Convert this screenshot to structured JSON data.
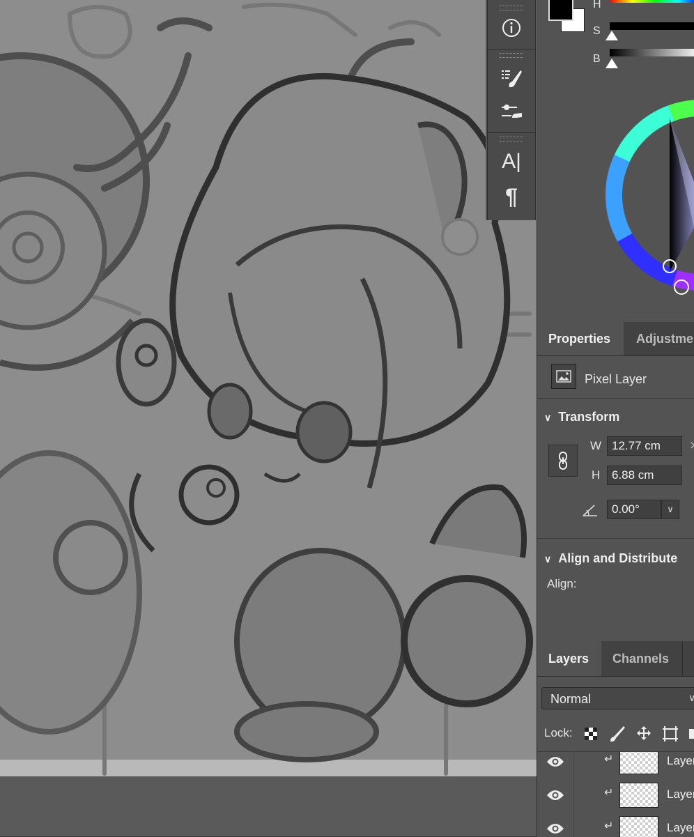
{
  "toolbar_strip": {
    "tools": [
      {
        "icon": "info-icon",
        "glyph": "ⓘ"
      },
      {
        "icon": "brush-presets-icon",
        "glyph": ""
      },
      {
        "icon": "brush-settings-icon",
        "glyph": ""
      },
      {
        "icon": "character-icon",
        "glyph": "A|"
      },
      {
        "icon": "paragraph-icon",
        "glyph": "¶"
      }
    ]
  },
  "color_panel": {
    "channels": [
      {
        "label": "H"
      },
      {
        "label": "S"
      },
      {
        "label": "B"
      }
    ],
    "foreground_color": "#000000",
    "background_color": "#ffffff"
  },
  "properties_panel": {
    "tabs": [
      {
        "label": "Properties",
        "active": true
      },
      {
        "label": "Adjustme",
        "active": false
      }
    ],
    "layer_type": "Pixel Layer",
    "transform": {
      "title": "Transform",
      "w_label": "W",
      "w_value": "12.77 cm",
      "h_label": "H",
      "h_value": "6.88 cm",
      "angle_value": "0.00°"
    },
    "align": {
      "title": "Align and Distribute",
      "align_label": "Align:"
    }
  },
  "layers_panel": {
    "tabs": [
      {
        "label": "Layers",
        "active": true
      },
      {
        "label": "Channels",
        "active": false
      }
    ],
    "blend_mode": "Normal",
    "lock_label": "Lock:",
    "layers": [
      {
        "name": "Layer"
      },
      {
        "name": "Layer"
      },
      {
        "name": "Layer"
      }
    ]
  },
  "colors": {
    "panel_bg": "#535353",
    "tab_bar_bg": "#424242",
    "canvas_gray": "#8b8b8b"
  }
}
